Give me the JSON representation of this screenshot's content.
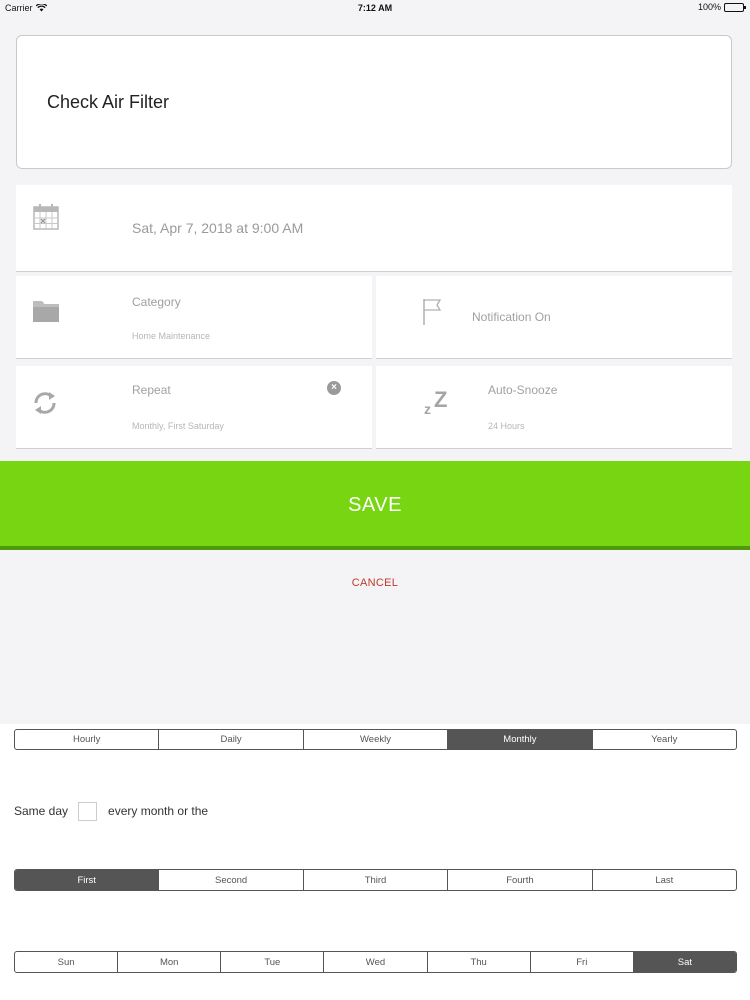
{
  "status_bar": {
    "carrier": "Carrier",
    "time": "7:12 AM",
    "battery": "100%"
  },
  "task": {
    "title": "Check Air Filter"
  },
  "date": {
    "value": "Sat, Apr 7, 2018 at 9:00 AM",
    "icon": "calendar-icon"
  },
  "category": {
    "label": "Category",
    "value": "Home Maintenance",
    "icon": "folder-icon"
  },
  "notification": {
    "label": "Notification On",
    "icon": "flag-icon"
  },
  "repeat": {
    "label": "Repeat",
    "value": "Monthly, First Saturday",
    "icon": "repeat-icon",
    "clear_icon": "clear-icon"
  },
  "snooze": {
    "label": "Auto-Snooze",
    "value": "24 Hours",
    "icon": "snooze-icon",
    "icon_text": "zZ"
  },
  "actions": {
    "save": "SAVE",
    "cancel": "CANCEL"
  },
  "frequency": {
    "options": [
      "Hourly",
      "Daily",
      "Weekly",
      "Monthly",
      "Yearly"
    ],
    "selected": "Monthly"
  },
  "same_day": {
    "prefix": "Same day",
    "suffix": "every month or the",
    "checked": false
  },
  "ordinal": {
    "options": [
      "First",
      "Second",
      "Third",
      "Fourth",
      "Last"
    ],
    "selected": "First"
  },
  "weekday": {
    "options": [
      "Sun",
      "Mon",
      "Tue",
      "Wed",
      "Thu",
      "Fri",
      "Sat"
    ],
    "selected": "Sat"
  },
  "colors": {
    "accent_green": "#77d611",
    "cancel_red": "#c0392b",
    "segment_selected": "#555555"
  }
}
